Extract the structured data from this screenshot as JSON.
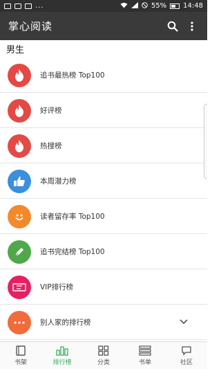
{
  "status": {
    "battery": "55%",
    "time": "14:48",
    "dots": "..."
  },
  "appbar": {
    "title": "掌心阅读",
    "search_icon": "search-icon",
    "menu_icon": "more-vert-icon"
  },
  "section": {
    "title": "男生"
  },
  "rankings": [
    {
      "label": "追书最热榜 Top100",
      "icon": "flame-icon",
      "color": "#e34a45"
    },
    {
      "label": "好评榜",
      "icon": "flame-icon",
      "color": "#e34a45"
    },
    {
      "label": "热搜榜",
      "icon": "flame-icon",
      "color": "#e34a45"
    },
    {
      "label": "本周潜力榜",
      "icon": "thumbs-up-icon",
      "color": "#3b8fdc"
    },
    {
      "label": "读者留存率 Top100",
      "icon": "smile-icon",
      "color": "#f28a2d"
    },
    {
      "label": "追书完结榜 Top100",
      "icon": "pen-icon",
      "color": "#4fa84a"
    },
    {
      "label": "VIP排行榜",
      "icon": "ticket-icon",
      "color": "#e52163"
    },
    {
      "label": "别人家的排行榜",
      "icon": "dots-icon",
      "color": "#f26b3a"
    }
  ],
  "tabs": [
    {
      "label": "书架",
      "icon": "bookshelf-icon",
      "active": false
    },
    {
      "label": "排行榜",
      "icon": "ranking-icon",
      "active": true
    },
    {
      "label": "分类",
      "icon": "grid-icon",
      "active": false
    },
    {
      "label": "书单",
      "icon": "booklist-icon",
      "active": false
    },
    {
      "label": "社区",
      "icon": "community-icon",
      "active": false
    }
  ],
  "colors": {
    "appbar": "#3a3a3a",
    "active_tab": "#33b05a"
  }
}
